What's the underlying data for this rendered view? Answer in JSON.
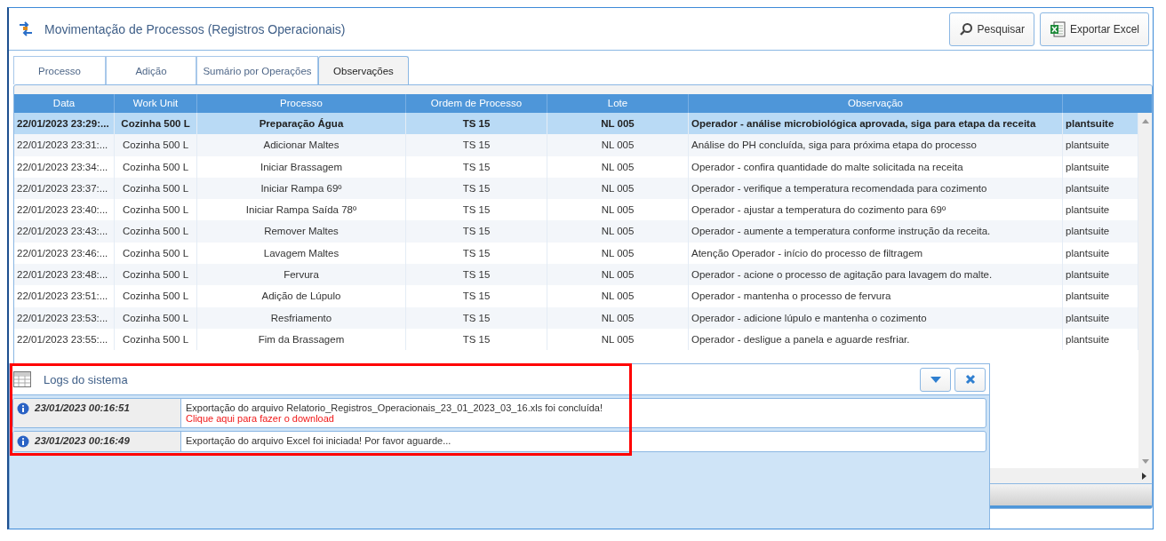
{
  "window": {
    "title": "Movimentação de Processos (Registros Operacionais)"
  },
  "toolbar": {
    "buttons": [
      {
        "kind": "search",
        "label": "Pesquisar"
      },
      {
        "kind": "excel",
        "label": "Exportar Excel"
      }
    ]
  },
  "tabs": [
    {
      "label": "Processo",
      "selected": false
    },
    {
      "label": "Adição",
      "selected": false
    },
    {
      "label": "Sumário por Operações",
      "selected": false
    },
    {
      "label": "Observações",
      "selected": true
    }
  ],
  "table": {
    "columns": [
      "Data",
      "Work Unit",
      "Processo",
      "Ordem de Processo",
      "Lote",
      "Observação"
    ],
    "rows": [
      {
        "selected": true,
        "cells": [
          "22/01/2023 23:29:...",
          "Cozinha 500 L",
          "Preparação Água",
          "TS 15",
          "NL 005",
          "Operador - análise microbiológica aprovada, siga para etapa da receita",
          "plantsuite"
        ]
      },
      {
        "selected": false,
        "cells": [
          "22/01/2023 23:31:...",
          "Cozinha 500 L",
          "Adicionar Maltes",
          "TS 15",
          "NL 005",
          "Análise do PH concluída, siga para próxima etapa do processo",
          "plantsuite"
        ]
      },
      {
        "selected": false,
        "cells": [
          "22/01/2023 23:34:...",
          "Cozinha 500 L",
          "Iniciar Brassagem",
          "TS 15",
          "NL 005",
          "Operador - confira quantidade do malte solicitada na receita",
          "plantsuite"
        ]
      },
      {
        "selected": false,
        "cells": [
          "22/01/2023 23:37:...",
          "Cozinha 500 L",
          "Iniciar Rampa 69º",
          "TS 15",
          "NL 005",
          "Operador - verifique a temperatura recomendada para cozimento",
          "plantsuite"
        ]
      },
      {
        "selected": false,
        "cells": [
          "22/01/2023 23:40:...",
          "Cozinha 500 L",
          "Iniciar Rampa Saída 78º",
          "TS 15",
          "NL 005",
          "Operador - ajustar a temperatura do cozimento para 69º",
          "plantsuite"
        ]
      },
      {
        "selected": false,
        "cells": [
          "22/01/2023 23:43:...",
          "Cozinha 500 L",
          "Remover Maltes",
          "TS 15",
          "NL 005",
          "Operador - aumente a temperatura conforme instrução da receita.",
          "plantsuite"
        ]
      },
      {
        "selected": false,
        "cells": [
          "22/01/2023 23:46:...",
          "Cozinha 500 L",
          "Lavagem Maltes",
          "TS 15",
          "NL 005",
          "Atenção Operador - início do processo de filtragem",
          "plantsuite"
        ]
      },
      {
        "selected": false,
        "cells": [
          "22/01/2023 23:48:...",
          "Cozinha 500 L",
          "Fervura",
          "TS 15",
          "NL 005",
          "Operador - acione o processo de agitação para lavagem do malte.",
          "plantsuite"
        ]
      },
      {
        "selected": false,
        "cells": [
          "22/01/2023 23:51:...",
          "Cozinha 500 L",
          "Adição de Lúpulo",
          "TS 15",
          "NL 005",
          "Operador - mantenha o processo de fervura",
          "plantsuite"
        ]
      },
      {
        "selected": false,
        "cells": [
          "22/01/2023 23:53:...",
          "Cozinha 500 L",
          "Resfriamento",
          "TS 15",
          "NL 005",
          "Operador - adicione lúpulo e mantenha o cozimento",
          "plantsuite"
        ]
      },
      {
        "selected": false,
        "cells": [
          "22/01/2023 23:55:...",
          "Cozinha 500 L",
          "Fim da Brassagem",
          "TS 15",
          "NL 005",
          "Operador - desligue a panela e aguarde resfriar.",
          "plantsuite"
        ]
      }
    ]
  },
  "logs_panel": {
    "title": "Logs do sistema",
    "highlighted": true,
    "entries": [
      {
        "time": "23/01/2023 00:16:51",
        "message": "Exportação do arquivo Relatorio_Registros_Operacionais_23_01_2023_03_16.xls foi concluída!",
        "link": "Clique aqui para fazer o download"
      },
      {
        "time": "23/01/2023 00:16:49",
        "message": "Exportação do arquivo Excel foi iniciada! Por favor aguarde..."
      }
    ]
  }
}
